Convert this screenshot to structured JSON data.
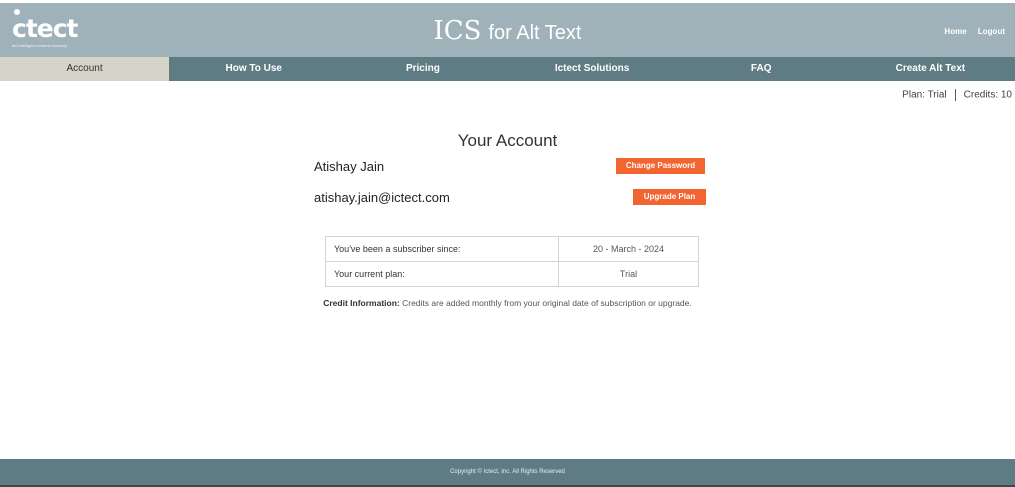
{
  "header": {
    "logo_text": "ctect",
    "logo_tagline": "the intelligent content company",
    "title_main": "ICS",
    "title_sub": "for Alt Text",
    "links": {
      "home": "Home",
      "logout": "Logout"
    }
  },
  "nav": {
    "items": [
      {
        "label": "Account",
        "active": true
      },
      {
        "label": "How To Use"
      },
      {
        "label": "Pricing"
      },
      {
        "label": "Ictect Solutions"
      },
      {
        "label": "FAQ"
      },
      {
        "label": "Create Alt Text"
      }
    ]
  },
  "plan_info": {
    "plan": "Plan: Trial",
    "credits": "Credits: 10"
  },
  "account": {
    "title": "Your Account",
    "name": "Atishay Jain",
    "email": "atishay.jain@ictect.com",
    "change_password_label": "Change Password",
    "upgrade_plan_label": "Upgrade Plan",
    "rows": [
      {
        "label": "You've been a subscriber since:",
        "value": "20 - March - 2024"
      },
      {
        "label": "Your current plan:",
        "value": "Trial"
      }
    ],
    "credit_info_label": "Credit Information:",
    "credit_info_text": "Credits are added monthly from your original date of subscription or upgrade."
  },
  "footer": {
    "copyright": "Copyright © Ictect, Inc. All Rights Reserved"
  },
  "colors": {
    "header_bg": "#9fb2b9",
    "nav_bg": "#5f7c84",
    "nav_active_bg": "#d5d4c8",
    "button": "#f26430"
  }
}
